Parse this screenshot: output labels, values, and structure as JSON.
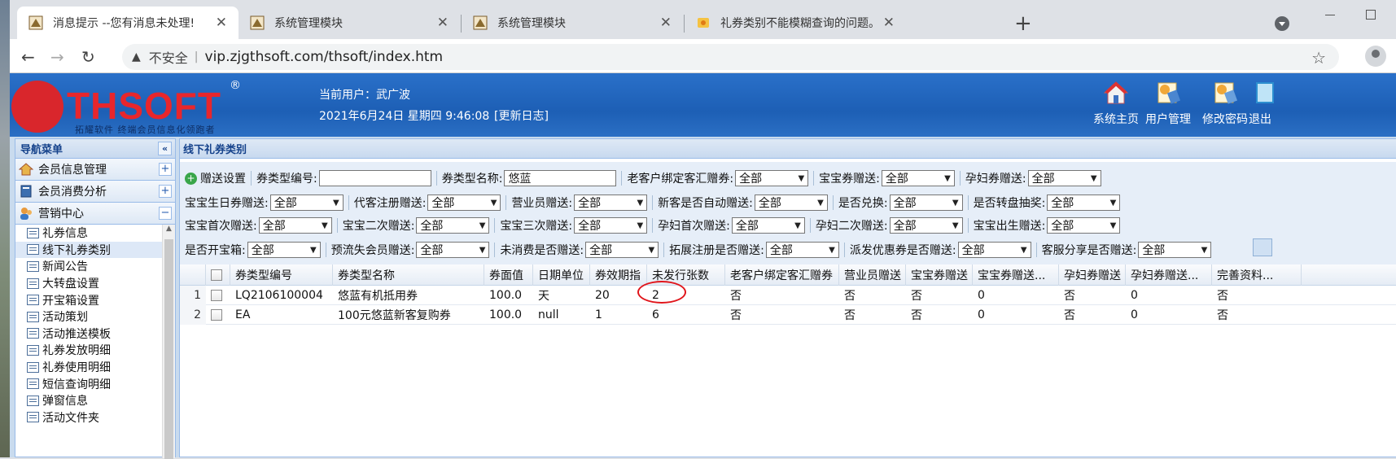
{
  "browser": {
    "tabs": [
      {
        "title": "消息提示  --您有消息未处理!"
      },
      {
        "title": "系统管理模块"
      },
      {
        "title": "系统管理模块"
      },
      {
        "title": "礼券类别不能模糊查询的问题。"
      }
    ],
    "security_label": "不安全",
    "url": "vip.zjgthsoft.com/thsoft/index.htm"
  },
  "header": {
    "logo_text": "THSOFT",
    "logo_tagline": "拓耀软件   终端会员信息化领跑者",
    "current_user": "当前用户：武广波",
    "datetime": "2021年6月24日 星期四 9:46:08",
    "changelog": "[更新日志]",
    "buttons": [
      {
        "label": "系统主页",
        "icon": "home-icon"
      },
      {
        "label": "用户管理",
        "icon": "user-management-icon"
      },
      {
        "label": "修改密码",
        "icon": "change-password-icon"
      },
      {
        "label": "退出",
        "icon": "logout-icon"
      }
    ]
  },
  "sidebar": {
    "title": "导航菜单",
    "groups": [
      {
        "label": "会员信息管理",
        "toggle": "+"
      },
      {
        "label": "会员消费分析",
        "toggle": "+"
      },
      {
        "label": "营销中心",
        "toggle": "−"
      }
    ],
    "items": [
      "礼券信息",
      "线下礼券类别",
      "新闻公告",
      "大转盘设置",
      "开宝箱设置",
      "活动策划",
      "活动推送模板",
      "礼券发放明细",
      "礼券使用明细",
      "短信查询明细",
      "弹窗信息",
      "活动文件夹"
    ],
    "selected_index": 1
  },
  "main": {
    "title": "线下礼券类别",
    "gift_button": "赠送设置",
    "filters": {
      "type_code_label": "券类型编号:",
      "type_code_value": "",
      "type_name_label": "券类型名称:",
      "type_name_value": "悠蓝",
      "selects": [
        {
          "label": "老客户绑定客汇赠券:",
          "value": "全部"
        },
        {
          "label": "宝宝券赠送:",
          "value": "全部"
        },
        {
          "label": "孕妇券赠送:",
          "value": "全部"
        },
        {
          "label": "宝宝生日券赠送:",
          "value": "全部"
        },
        {
          "label": "代客注册赠送:",
          "value": "全部"
        },
        {
          "label": "营业员赠送:",
          "value": "全部"
        },
        {
          "label": "新客是否自动赠送:",
          "value": "全部"
        },
        {
          "label": "是否兑换:",
          "value": "全部"
        },
        {
          "label": "是否转盘抽奖:",
          "value": "全部"
        },
        {
          "label": "宝宝首次赠送:",
          "value": "全部"
        },
        {
          "label": "宝宝二次赠送:",
          "value": "全部"
        },
        {
          "label": "宝宝三次赠送:",
          "value": "全部"
        },
        {
          "label": "孕妇首次赠送:",
          "value": "全部"
        },
        {
          "label": "孕妇二次赠送:",
          "value": "全部"
        },
        {
          "label": "宝宝出生赠送:",
          "value": "全部"
        },
        {
          "label": "是否开宝箱:",
          "value": "全部"
        },
        {
          "label": "预流失会员赠送:",
          "value": "全部"
        },
        {
          "label": "未消费是否赠送:",
          "value": "全部"
        },
        {
          "label": "拓展注册是否赠送:",
          "value": "全部"
        },
        {
          "label": "派发优惠券是否赠送:",
          "value": "全部"
        },
        {
          "label": "客服分享是否赠送:",
          "value": "全部"
        }
      ]
    },
    "table": {
      "columns": [
        "券类型编号",
        "券类型名称",
        "券面值",
        "日期单位",
        "券效期指",
        "未发行张数",
        "老客户绑定客汇赠券",
        "营业员赠送",
        "宝宝券赠送",
        "宝宝券赠送...",
        "孕妇券赠送",
        "孕妇券赠送...",
        "完善资料..."
      ],
      "rows": [
        {
          "num": "1",
          "cells": [
            "LQ2106100004",
            "悠蓝有机抵用券",
            "100.0",
            "天",
            "20",
            "2",
            "否",
            "否",
            "否",
            "0",
            "否",
            "0",
            "否"
          ]
        },
        {
          "num": "2",
          "cells": [
            "EA",
            "100元悠蓝新客复购券",
            "100.0",
            "null",
            "1",
            "6",
            "否",
            "否",
            "否",
            "0",
            "否",
            "0",
            "否"
          ]
        }
      ]
    }
  }
}
